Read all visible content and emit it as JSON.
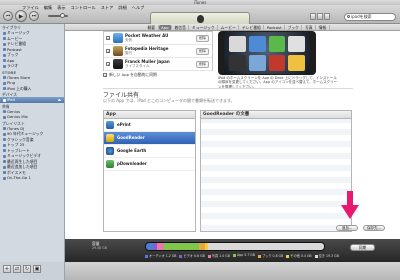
{
  "window": {
    "title": "iTunes"
  },
  "menu": [
    "ファイル",
    "編集",
    "表示",
    "コントロール",
    "ストア",
    "詳細",
    "ヘルプ"
  ],
  "search": {
    "placeholder": "ipadを検索"
  },
  "sidebar": {
    "sections": [
      {
        "header": "ライブラリ",
        "items": [
          "ミュージック",
          "ムービー",
          "テレビ番組",
          "Podcast",
          "ブック",
          "App",
          "ラジオ"
        ]
      },
      {
        "header": "STORE",
        "items": [
          "iTunes Store",
          "Ping",
          "iPod 上の購入"
        ]
      },
      {
        "header": "デバイス",
        "items": [
          "iPad"
        ]
      },
      {
        "header": "共有",
        "items": [
          "Genius",
          "Genius Mix"
        ]
      },
      {
        "header": "プレイリスト",
        "items": [
          "iTunes DJ",
          "90 年代ミュージック",
          "クラシック音楽",
          "トップ 25",
          "トップレート",
          "ミュージックビデオ",
          "最近再生した項目",
          "最近追加した項目",
          "ボイスメモ",
          "On-The-Go 1"
        ]
      }
    ]
  },
  "tabs": [
    "概要",
    "App",
    "着信音",
    "ミュージック",
    "ムービー",
    "テレビ番組",
    "Podcast",
    "ブック",
    "写真",
    "情報"
  ],
  "active_tab": "App",
  "app_list": [
    {
      "name": "Pocket Weather AU",
      "sub": "天気"
    },
    {
      "name": "Fotopedia Heritage",
      "sub": "旅行"
    },
    {
      "name": "Franck Muller Japan",
      "sub": "ライフスタイル"
    }
  ],
  "auto_sync_label": "新しい App を自動的に同期",
  "remove_label": "削除",
  "phone_note": "iPad のホームスクリーンを App の Dock 上にドラッグして、インストールの順序を変更してください。App のアイコンを並べ替えて、ホームスクリーンを整理してください。",
  "file_sharing": {
    "title": "ファイル共有",
    "desc": "以下の App では、iPad とこのコンピュータの間で書類を転送できます。",
    "app_header": "App",
    "docs_header": "GoodReader の文書",
    "apps": [
      "ePrint",
      "GoodReader",
      "Google Earth",
      "pDownloader"
    ],
    "selected": "GoodReader",
    "add_button": "追加...",
    "save_button": "保存先..."
  },
  "capacity": {
    "label": "容量",
    "total": "29.08 GB",
    "segments": [
      {
        "name": "オーディオ",
        "value": "1.2 GB",
        "color": "#4a7fd6"
      },
      {
        "name": "ビデオ",
        "value": "0.6 GB",
        "color": "#8a5dc9"
      },
      {
        "name": "写真",
        "value": "1.0 GB",
        "color": "#e27ba9"
      },
      {
        "name": "App",
        "value": "5.7 GB",
        "color": "#7fc64a"
      },
      {
        "name": "ブック",
        "value": "0.8 GB",
        "color": "#e6a73d"
      },
      {
        "name": "その他",
        "value": "0.4 GB",
        "color": "#f0d040"
      },
      {
        "name": "空き",
        "value": "19.3 GB",
        "color": "#d9d9d9"
      }
    ],
    "sync_button": "同期"
  }
}
